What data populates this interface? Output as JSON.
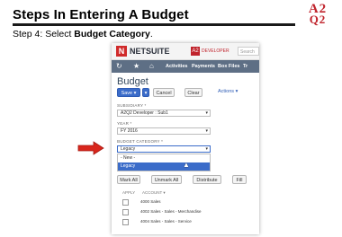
{
  "slide": {
    "title": "Steps In Entering A Budget",
    "step_prefix": "Step 4: Select ",
    "step_bold": "Budget Category",
    "step_suffix": ".",
    "logo_line1": "A2",
    "logo_line2": "Q2"
  },
  "netsuite": {
    "logo_text": "NETSUITE",
    "dev_badge": "DEVELOPER",
    "search_placeholder": "Search",
    "nav": [
      "Activities",
      "Payments",
      "Box Files",
      "Tr"
    ],
    "page_title": "Budget",
    "buttons": {
      "save": "Save",
      "cancel": "Cancel",
      "clear": "Clear",
      "actions": "Actions"
    },
    "fields": {
      "subsidiary_label": "SUBSIDIARY *",
      "subsidiary_value": "A2Q2 Developer : Sub1",
      "year_label": "YEAR *",
      "year_value": "FY 2016",
      "category_label": "BUDGET CATEGORY *",
      "category_value": "Legacy"
    },
    "dropdown_options": [
      "- New -",
      "Legacy"
    ],
    "list_buttons": {
      "mark_all": "Mark All",
      "unmark_all": "Unmark All",
      "distribute": "Distribute",
      "fill": "Fill"
    },
    "table": {
      "headers": [
        "APPLY",
        "ACCOUNT"
      ],
      "rows": [
        "4000 Sales",
        "4002 Sales - Sales - Merchandise",
        "4004 Sales - Sales - Service"
      ]
    }
  },
  "colors": {
    "nav_bar": "#5e6f85",
    "save_button": "#3b6cc9",
    "arrow": "#d9261c"
  }
}
